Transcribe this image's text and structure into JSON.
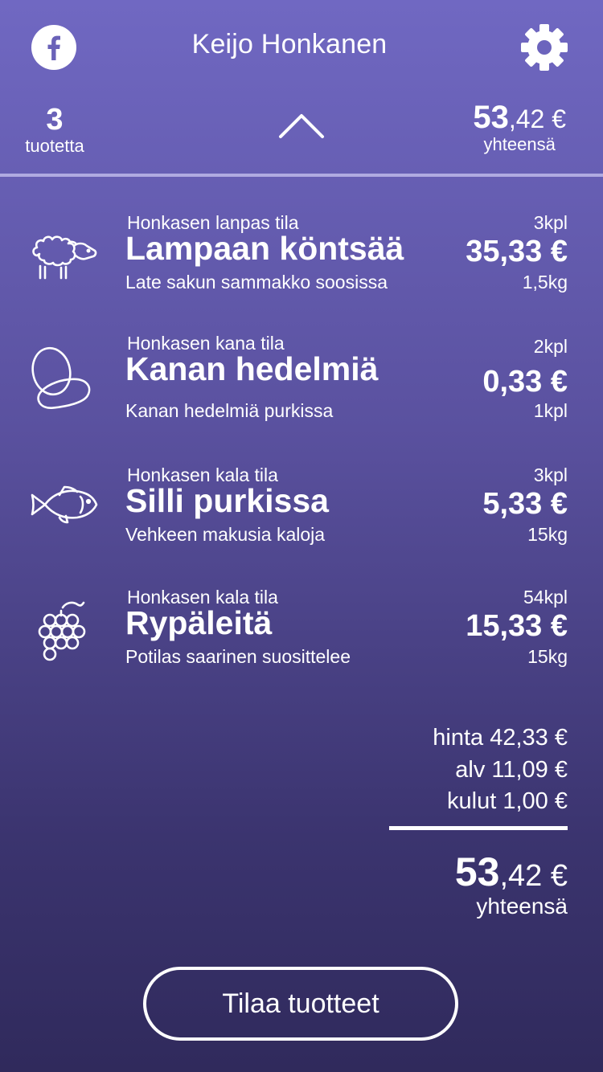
{
  "header": {
    "user_name": "Keijo Honkanen",
    "facebook_icon": "facebook-icon",
    "settings_icon": "gear-icon"
  },
  "summary": {
    "count": "3",
    "count_label": "tuotetta",
    "total_int": "53",
    "total_dec": ",42 €",
    "total_label": "yhteensä"
  },
  "products": [
    {
      "icon": "sheep-icon",
      "farm": "Honkasen lanpas tila",
      "name": "Lampaan köntsää",
      "desc": "Late sakun sammakko soosissa",
      "qty": "3kpl",
      "price": "35,33 €",
      "weight": "1,5kg"
    },
    {
      "icon": "eggs-icon",
      "farm": "Honkasen kana tila",
      "name": "Kanan hedelmiä",
      "desc": "Kanan hedelmiä purkissa",
      "qty": "2kpl",
      "price": "0,33 €",
      "weight": "1kpl"
    },
    {
      "icon": "fish-icon",
      "farm": "Honkasen kala tila",
      "name": "Silli purkissa",
      "desc": "Vehkeen makusia kaloja",
      "qty": "3kpl",
      "price": "5,33 €",
      "weight": "15kg"
    },
    {
      "icon": "grapes-icon",
      "farm": "Honkasen kala tila",
      "name": "Rypäleitä",
      "desc": "Potilas saarinen suosittelee",
      "qty": "54kpl",
      "price": "15,33 €",
      "weight": "15kg"
    }
  ],
  "totals": {
    "price_line": "hinta 42,33 €",
    "vat_line": "alv 11,09 €",
    "costs_line": "kulut 1,00 €",
    "total_int": "53",
    "total_dec": ",42 €",
    "total_label": "yhteensä"
  },
  "order_button": "Tilaa tuotteet"
}
